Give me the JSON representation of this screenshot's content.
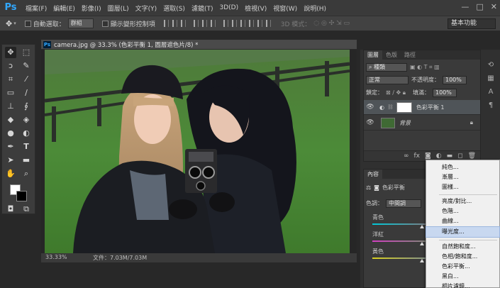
{
  "app": {
    "logo": "Ps"
  },
  "menu": {
    "items": [
      "檔案(F)",
      "編輯(E)",
      "影像(I)",
      "圖層(L)",
      "文字(Y)",
      "選取(S)",
      "濾鏡(T)",
      "3D(D)",
      "檢視(V)",
      "視窗(W)",
      "說明(H)"
    ],
    "window_controls": [
      "—",
      "□",
      "✕"
    ]
  },
  "options_bar": {
    "auto_select_label": "自動選取：",
    "auto_select_value": "群組",
    "transform_controls_label": "顯示變形控制項",
    "mode_3d_label": "3D 模式：",
    "workspace": "基本功能"
  },
  "document": {
    "tab_title": "camera.jpg @ 33.3% (色彩平衡 1, 圖層遮色片/8) *",
    "zoom": "33.33%",
    "file_info": "文件：7.03M/7.03M"
  },
  "layers_panel": {
    "tabs": [
      "圖層",
      "色版",
      "路徑"
    ],
    "filter_kind": "種類",
    "blend_mode": "正常",
    "opacity_label": "不透明度：",
    "opacity_value": "100%",
    "lock_label": "鎖定：",
    "fill_label": "填滿：",
    "fill_value": "100%",
    "layers": [
      {
        "name": "色彩平衡 1",
        "visible": true,
        "selected": true
      },
      {
        "name": "背景",
        "visible": true,
        "selected": false
      }
    ]
  },
  "properties_panel": {
    "tab": "內容",
    "title": "色彩平衡",
    "tone_label": "色調：",
    "tone_value": "中間調",
    "sliders": [
      {
        "left": "青色",
        "color_from": "#00c8d8",
        "color_to": "#e04040",
        "value": 0
      },
      {
        "left": "洋紅",
        "color_from": "#d040c0",
        "color_to": "#40c040",
        "value": 0
      },
      {
        "left": "黃色",
        "color_from": "#d8d020",
        "color_to": "#4060e0",
        "value": 0
      }
    ]
  },
  "adjustment_menu": {
    "items": [
      "純色...",
      "漸層...",
      "圖樣...",
      "亮度/對比...",
      "色階...",
      "曲線...",
      "曝光度...",
      "自然飽和度...",
      "色相/飽和度...",
      "色彩平衡...",
      "黑白...",
      "相片濾鏡..."
    ],
    "highlighted_index": 6
  },
  "colors": {
    "foreground": "#ffffff",
    "background": "#000000",
    "highlight": "#c8d8f0"
  }
}
